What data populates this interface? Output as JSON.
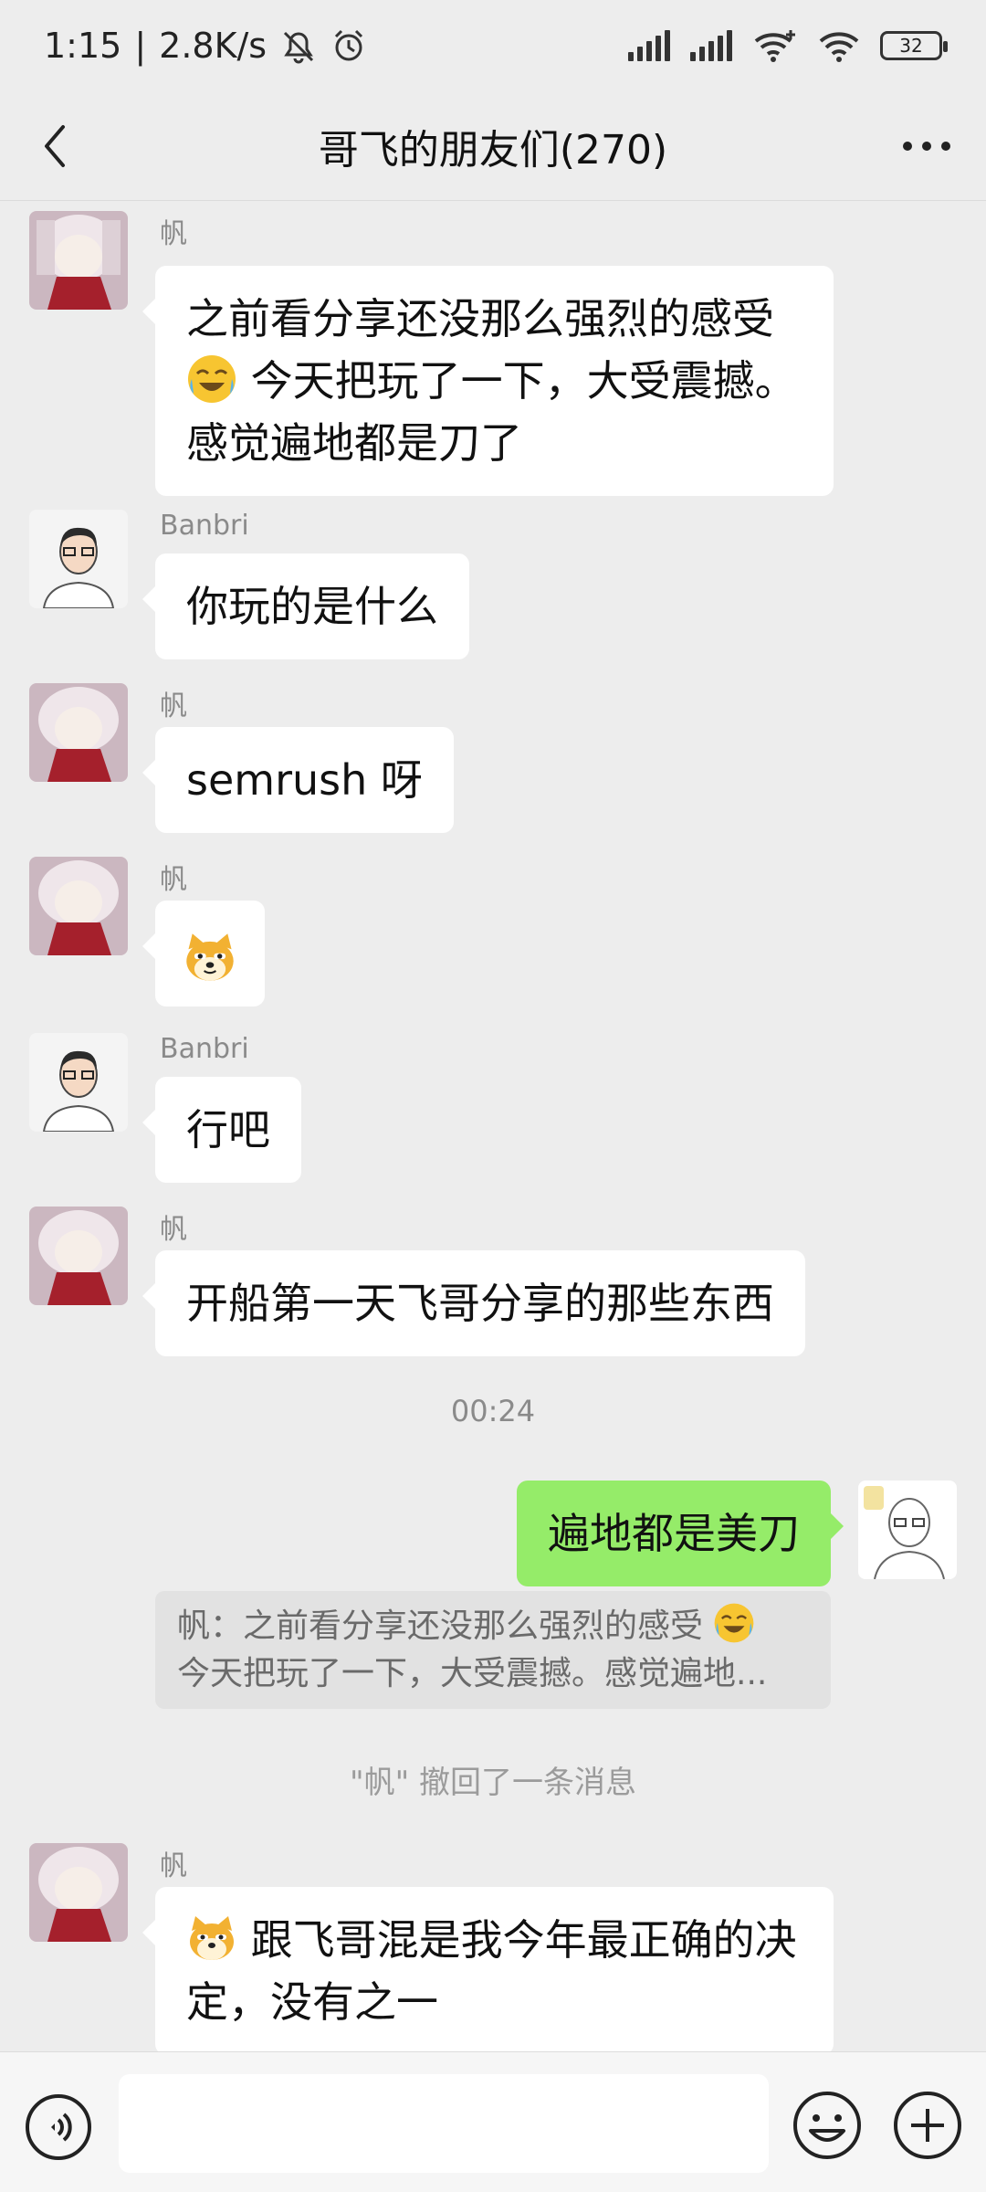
{
  "status_bar": {
    "time": "1:15",
    "speed": "2.8K/s",
    "battery": "32"
  },
  "nav": {
    "title": "哥飞的朋友们(270)"
  },
  "messages": [
    {
      "sender": "帆",
      "lines": [
        "之前看分享还没那么强烈的感受",
        "今天把玩了一下，大受震撼。",
        "感觉遍地都是刀了"
      ]
    },
    {
      "sender": "Banbri",
      "text": "你玩的是什么"
    },
    {
      "sender": "帆",
      "text": "semrush 呀"
    },
    {
      "sender": "帆",
      "sticker": "doge-emoji"
    },
    {
      "sender": "Banbri",
      "text": "行吧"
    },
    {
      "sender": "帆",
      "text": "开船第一天飞哥分享的那些东西"
    },
    {
      "sender": "帆",
      "lines": [
        "跟飞哥混是我今年最正确的决",
        "定，没有之一"
      ]
    }
  ],
  "timestamp": "00:24",
  "own_message": {
    "text": "遍地都是美刀",
    "quote_line1": "帆：之前看分享还没那么强烈的感受",
    "quote_line2": "今天把玩了一下，大受震撼。感觉遍地..."
  },
  "recall_note": "\"帆\" 撤回了一条消息",
  "colors": {
    "background": "#ededed",
    "own_bubble": "#95ec69",
    "other_bubble": "#ffffff"
  },
  "icons": [
    "back-arrow-icon",
    "more-icon",
    "voice-icon",
    "emoji-icon",
    "plus-icon"
  ]
}
